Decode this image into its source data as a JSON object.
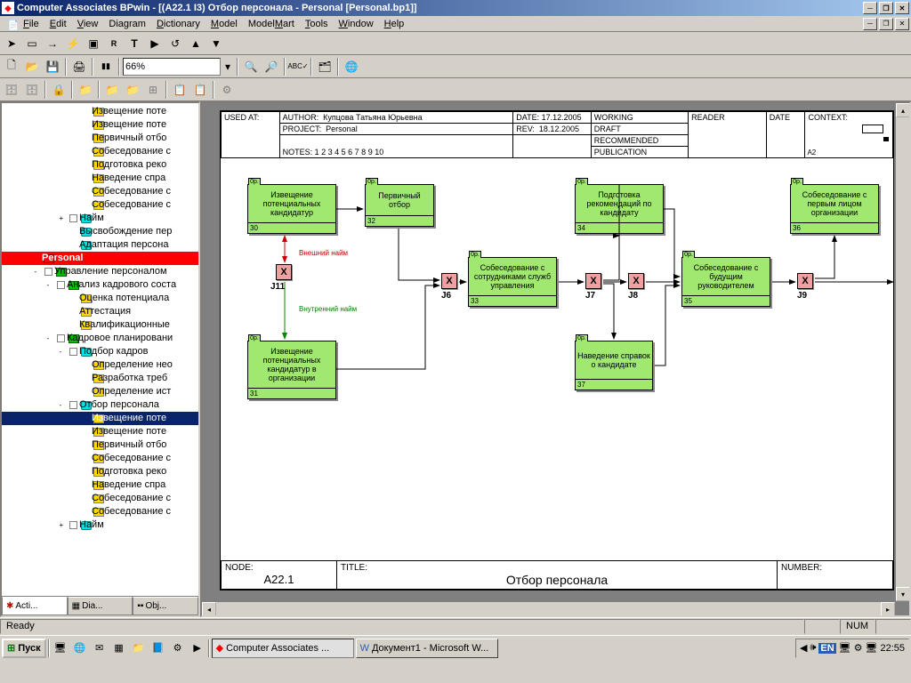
{
  "titlebar": {
    "text": "Computer Associates BPwin - [(A22.1 I3) Отбор персонала - Personal  [Personal.bp1]]"
  },
  "menu": {
    "file": "File",
    "edit": "Edit",
    "view": "View",
    "diagram": "Diagram",
    "dictionary": "Dictionary",
    "model": "Model",
    "modelmart": "ModelMart",
    "tools": "Tools",
    "window": "Window",
    "help": "Help"
  },
  "zoom": {
    "value": "66%"
  },
  "tree": {
    "items": [
      {
        "icon": "yel",
        "label": "Извещение поте",
        "lvl": 5
      },
      {
        "icon": "yel",
        "label": "Извещение поте",
        "lvl": 5
      },
      {
        "icon": "yel",
        "label": "Первичный отбо",
        "lvl": 5
      },
      {
        "icon": "yel",
        "label": "Собеседование с",
        "lvl": 5
      },
      {
        "icon": "yel",
        "label": "Подготовка реко",
        "lvl": 5
      },
      {
        "icon": "yel",
        "label": "Наведение спра",
        "lvl": 5
      },
      {
        "icon": "yel",
        "label": "Собеседование с",
        "lvl": 5
      },
      {
        "icon": "yel",
        "label": "Собеседование с",
        "lvl": 5
      },
      {
        "icon": "cyan",
        "label": "Найм",
        "lvl": 4,
        "exp": "+"
      },
      {
        "icon": "cyan",
        "label": "Высвобождение пер",
        "lvl": 4
      },
      {
        "icon": "cyan",
        "label": "Адаптация персона",
        "lvl": 4
      },
      {
        "icon": "red",
        "label": "Personal",
        "lvl": 1,
        "sel": "red"
      },
      {
        "icon": "grn",
        "label": "Управление персоналом",
        "lvl": 2,
        "exp": "-"
      },
      {
        "icon": "grn",
        "label": "Анализ кадрового соста",
        "lvl": 3,
        "exp": "-"
      },
      {
        "icon": "yel",
        "label": "Оценка потенциала",
        "lvl": 4
      },
      {
        "icon": "yel",
        "label": "Аттестация",
        "lvl": 4
      },
      {
        "icon": "yel",
        "label": "Квалификационные",
        "lvl": 4
      },
      {
        "icon": "grn",
        "label": "Кадровое планировани",
        "lvl": 3,
        "exp": "-"
      },
      {
        "icon": "cyan",
        "label": "Подбор кадров",
        "lvl": 4,
        "exp": "-"
      },
      {
        "icon": "yel",
        "label": "Определение нео",
        "lvl": 5
      },
      {
        "icon": "yel",
        "label": "Разработка треб",
        "lvl": 5
      },
      {
        "icon": "yel",
        "label": "Определение ист",
        "lvl": 5
      },
      {
        "icon": "cyan",
        "label": "Отбор персонала",
        "lvl": 4,
        "exp": "-"
      },
      {
        "icon": "yel",
        "label": "Извещение поте",
        "lvl": 5,
        "sel": "blue"
      },
      {
        "icon": "yel",
        "label": "Извещение поте",
        "lvl": 5
      },
      {
        "icon": "yel",
        "label": "Первичный отбо",
        "lvl": 5
      },
      {
        "icon": "yel",
        "label": "Собеседование с",
        "lvl": 5
      },
      {
        "icon": "yel",
        "label": "Подготовка реко",
        "lvl": 5
      },
      {
        "icon": "yel",
        "label": "Наведение спра",
        "lvl": 5
      },
      {
        "icon": "yel",
        "label": "Собеседование с",
        "lvl": 5
      },
      {
        "icon": "yel",
        "label": "Собеседование с",
        "lvl": 5
      },
      {
        "icon": "cyan",
        "label": "Найм",
        "lvl": 4,
        "exp": "+"
      }
    ],
    "tabs": {
      "acti": "Acti...",
      "dia": "Dia...",
      "obj": "Obj..."
    }
  },
  "header": {
    "used_at": "USED AT:",
    "author": "AUTHOR:",
    "author_val": "Купцова Татьяна Юрьевна",
    "project": "PROJECT:",
    "project_val": "Personal",
    "notes": "NOTES:  1  2  3  4  5  6  7  8  9  10",
    "date": "DATE:",
    "date_val": "17.12.2005",
    "rev": "REV:",
    "rev_val": "18.12.2005",
    "working": "WORKING",
    "draft": "DRAFT",
    "recommended": "RECOMMENDED",
    "publication": "PUBLICATION",
    "reader": "READER",
    "date2": "DATE",
    "context": "CONTEXT:",
    "context_val": "A2"
  },
  "footer": {
    "node": "NODE:",
    "node_val": "A22.1",
    "title": "TITLE:",
    "title_val": "Отбор персонала",
    "number": "NUMBER:"
  },
  "activities": {
    "a30": {
      "tab": "0р.",
      "text": "Извещение потенциальных кандидатур",
      "num": "30"
    },
    "a31": {
      "tab": "0р.",
      "text": "Извещение потенциальных кандидатур в организации",
      "num": "31"
    },
    "a32": {
      "tab": "0р.",
      "text": "Первичный отбор",
      "num": "32"
    },
    "a33": {
      "tab": "0р.",
      "text": "Собеседование с сотрудниками служб управления",
      "num": "33"
    },
    "a34": {
      "tab": "0р.",
      "text": "Подготовка рекомендаций по кандидату",
      "num": "34"
    },
    "a35": {
      "tab": "0р.",
      "text": "Собеседование с будущим руководителем",
      "num": "35"
    },
    "a36": {
      "tab": "0р.",
      "text": "Собеседование с первым лицом организации",
      "num": "36"
    },
    "a37": {
      "tab": "0р.",
      "text": "Наведение справок о кандидате",
      "num": "37"
    }
  },
  "junctions": {
    "j11": "J11",
    "j6": "J6",
    "j7": "J7",
    "j8": "J8",
    "j9": "J9"
  },
  "arrows": {
    "ext": "Внешний найм",
    "int": "Внутренний найм"
  },
  "status": {
    "ready": "Ready",
    "num": "NUM"
  },
  "taskbar": {
    "start": "Пуск",
    "app1": "Computer Associates ...",
    "app2": "Документ1 - Microsoft W...",
    "clock": "22:55",
    "lang": "EN"
  }
}
